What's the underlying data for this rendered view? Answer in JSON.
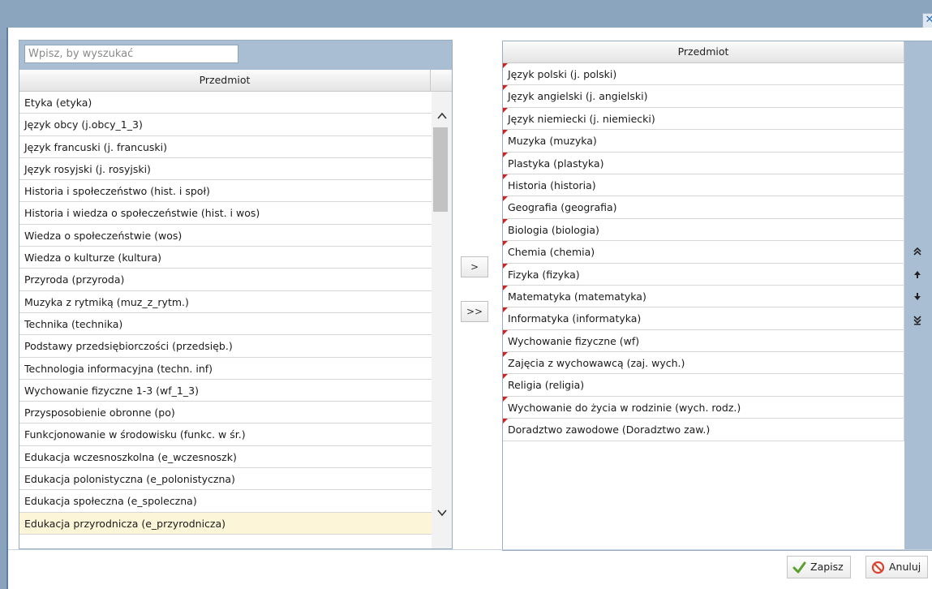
{
  "window": {
    "close_glyph": "✕"
  },
  "left_panel": {
    "search_placeholder": "Wpisz, by wyszukać",
    "column_header": "Przedmiot",
    "items": [
      "Etyka (etyka)",
      "Język obcy (j.obcy_1_3)",
      "Język francuski (j. francuski)",
      "Język rosyjski (j. rosyjski)",
      "Historia i społeczeństwo (hist. i społ)",
      "Historia i wiedza o społeczeństwie (hist. i wos)",
      "Wiedza o społeczeństwie (wos)",
      "Wiedza o kulturze (kultura)",
      "Przyroda (przyroda)",
      "Muzyka z rytmiką (muz_z_rytm.)",
      "Technika (technika)",
      "Podstawy przedsiębiorczości (przedsięb.)",
      "Technologia informacyjna (techn. inf)",
      "Wychowanie fizyczne 1-3 (wf_1_3)",
      "Przysposobienie obronne (po)",
      "Funkcjonowanie w środowisku (funkc. w śr.)",
      "Edukacja wczesnoszkolna (e_wczesnoszk)",
      "Edukacja polonistyczna (e_polonistyczna)",
      "Edukacja społeczna (e_spoleczna)",
      "Edukacja przyrodnicza (e_przyrodnicza)"
    ],
    "selected_item": "Edukacja przyrodnicza (e_przyrodnicza)",
    "scroll_up_glyph": "⌃",
    "scroll_down_glyph": "⌄"
  },
  "transfer": {
    "move_one_label": ">",
    "move_all_label": ">>"
  },
  "right_panel": {
    "column_header": "Przedmiot",
    "items": [
      "Język polski (j. polski)",
      "Język angielski (j. angielski)",
      "Język niemiecki (j. niemiecki)",
      "Muzyka (muzyka)",
      "Plastyka (plastyka)",
      "Historia (historia)",
      "Geografia (geografia)",
      "Biologia (biologia)",
      "Chemia (chemia)",
      "Fizyka (fizyka)",
      "Matematyka (matematyka)",
      "Informatyka (informatyka)",
      "Wychowanie fizyczne (wf)",
      "Zajęcia z wychowawcą (zaj. wych.)",
      "Religia (religia)",
      "Wychowanie do życia w rodzinie (wych. rodz.)",
      "Doradztwo zawodowe (Doradztwo zaw.)"
    ],
    "order_buttons": {
      "top": "⇞",
      "up": "↑",
      "down": "↓",
      "bottom": "⇟"
    }
  },
  "footer": {
    "save_label": "Zapisz",
    "cancel_label": "Anuluj"
  },
  "colors": {
    "save_icon": "#5aa02c",
    "cancel_icon": "#d9432f",
    "marker": "#cc2222",
    "selected_row": "#fcf5d8"
  }
}
